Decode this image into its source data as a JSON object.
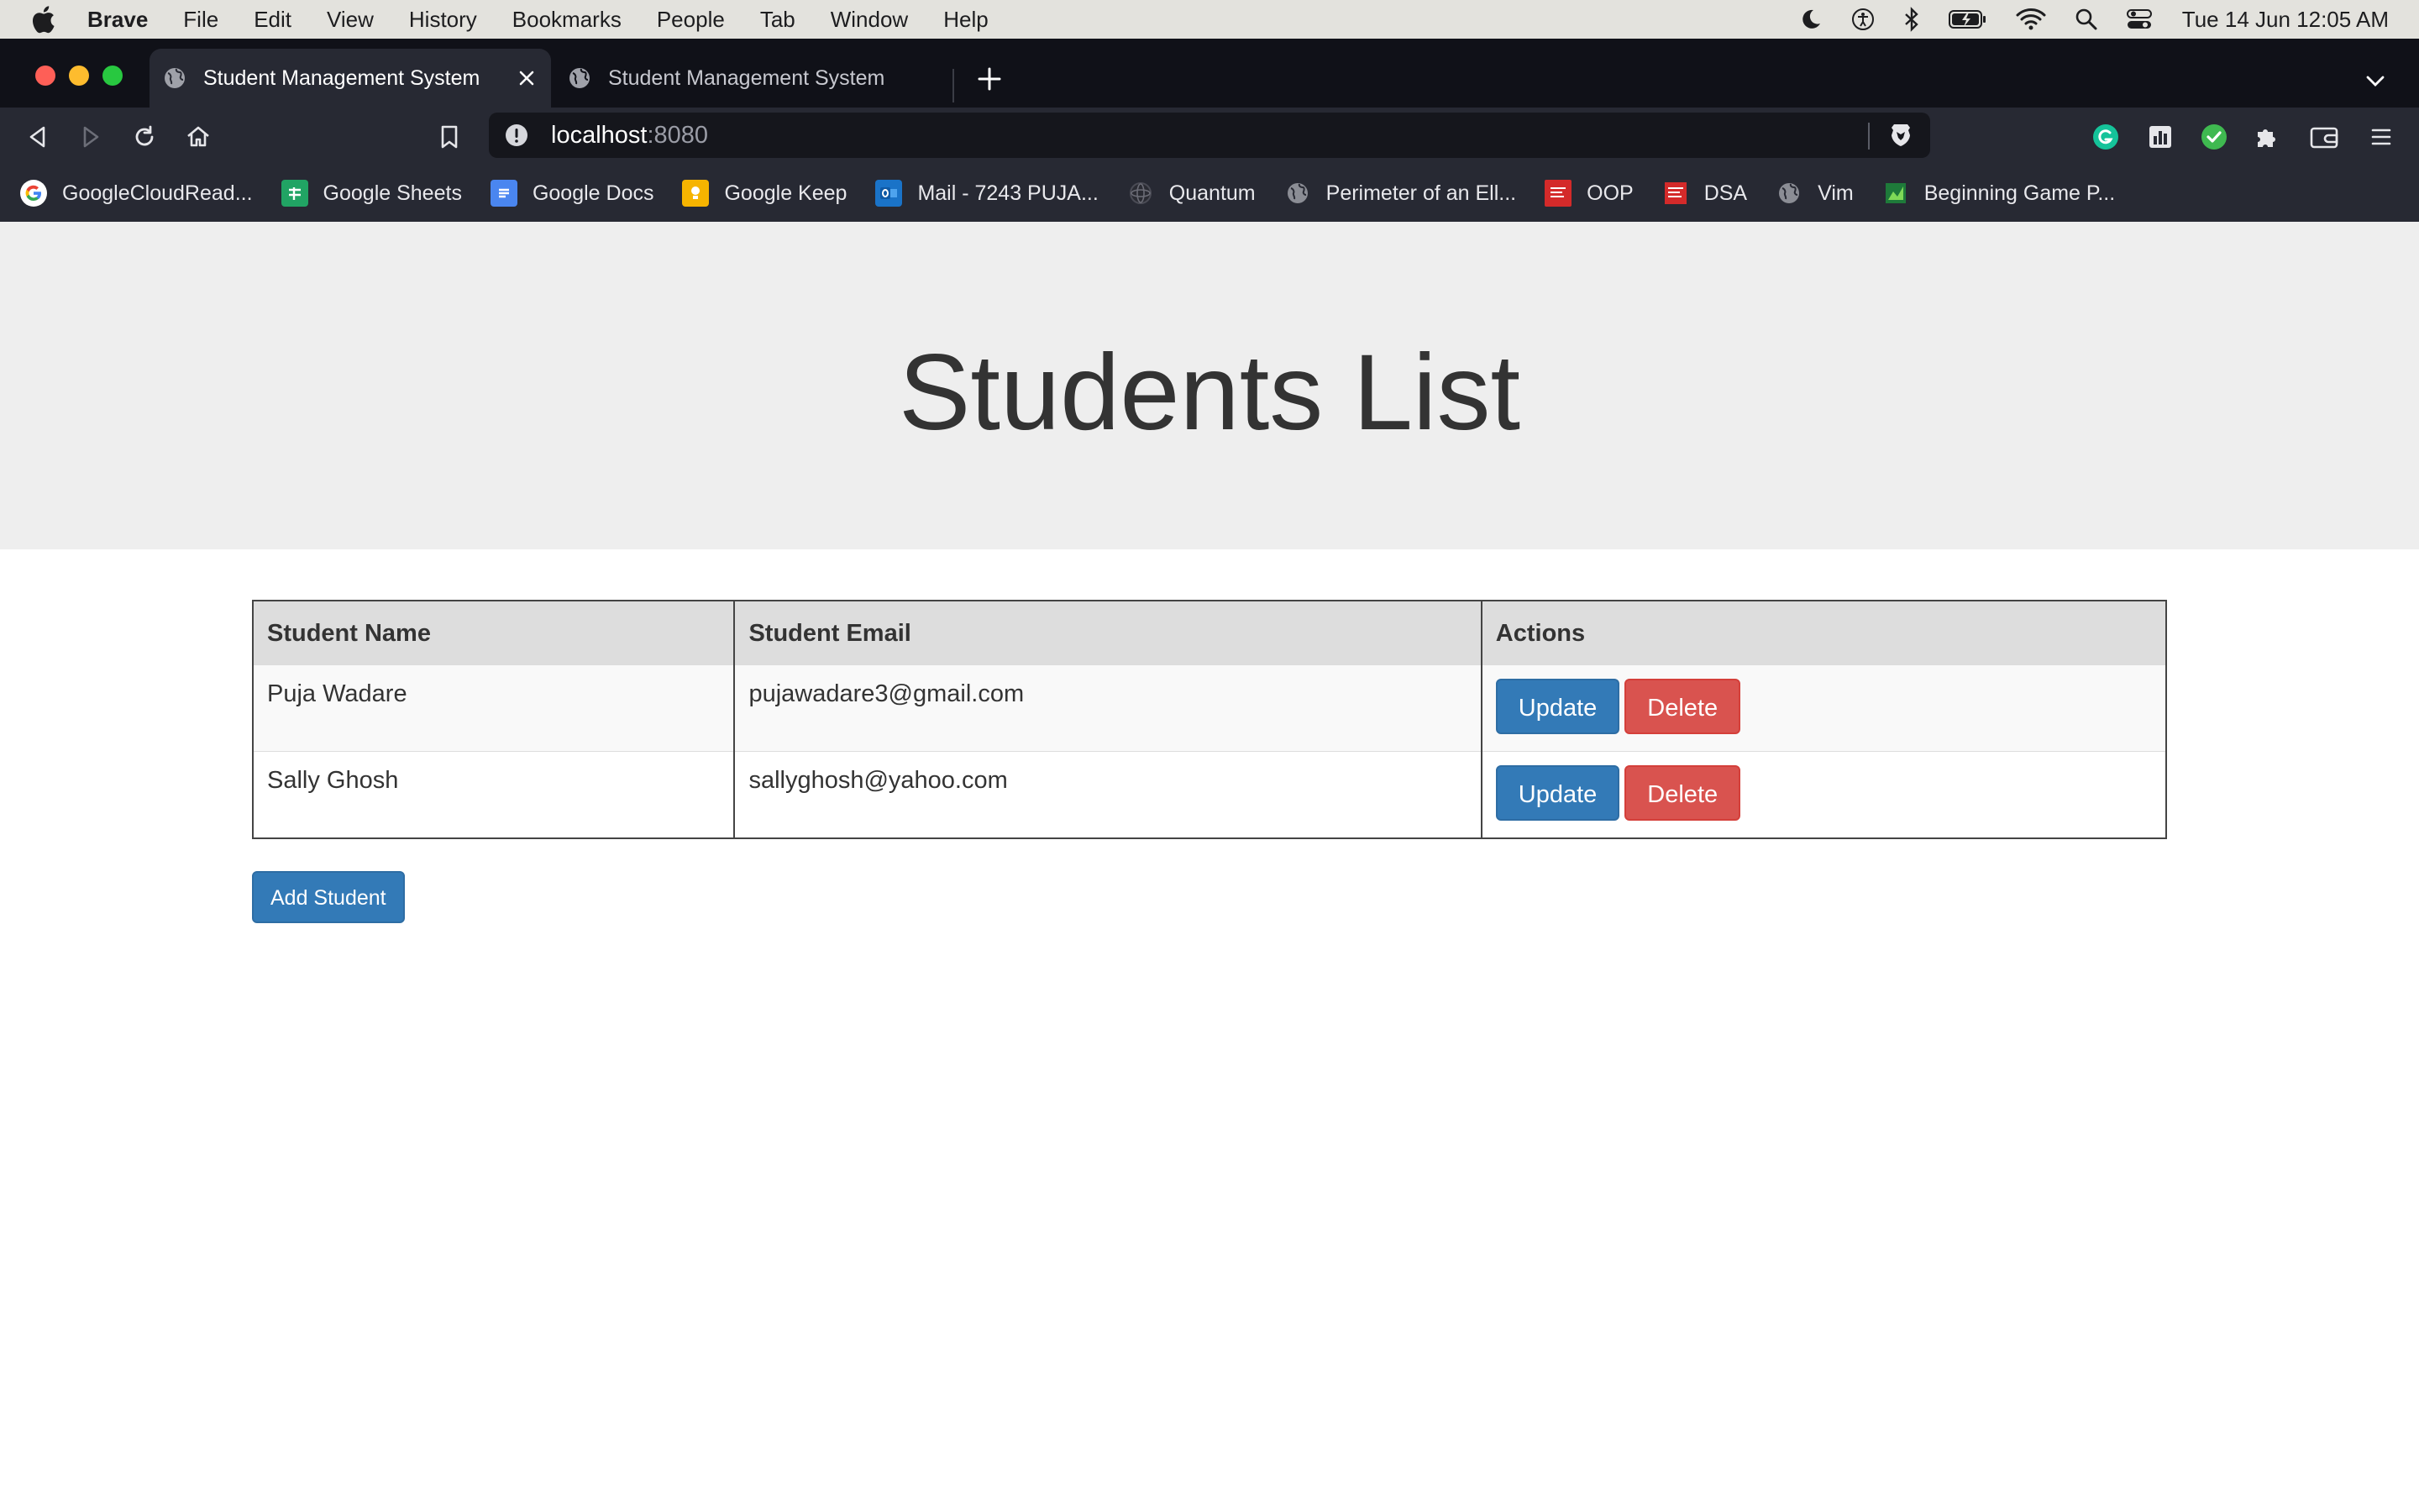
{
  "menubar": {
    "app_name": "Brave",
    "items": [
      "File",
      "Edit",
      "View",
      "History",
      "Bookmarks",
      "People",
      "Tab",
      "Window",
      "Help"
    ],
    "clock": "Tue 14 Jun  12:05 AM"
  },
  "tabs": [
    {
      "title": "Student Management System",
      "active": true
    },
    {
      "title": "Student Management System",
      "active": false
    }
  ],
  "address_bar": {
    "host": "localhost",
    "port": ":8080"
  },
  "bookmarks": [
    {
      "label": "GoogleCloudRead...",
      "icon": "google-g-icon"
    },
    {
      "label": "Google Sheets",
      "icon": "sheets-icon"
    },
    {
      "label": "Google Docs",
      "icon": "docs-icon"
    },
    {
      "label": "Google Keep",
      "icon": "keep-icon"
    },
    {
      "label": "Mail - 7243 PUJA...",
      "icon": "outlook-icon"
    },
    {
      "label": "Quantum",
      "icon": "quantum-icon"
    },
    {
      "label": "Perimeter of an Ell...",
      "icon": "globe-icon"
    },
    {
      "label": "OOP",
      "icon": "mcgraw-hill-icon"
    },
    {
      "label": "DSA",
      "icon": "mcgraw-hill-icon"
    },
    {
      "label": "Vim",
      "icon": "globe-icon"
    },
    {
      "label": "Beginning Game P...",
      "icon": "chart-icon"
    }
  ],
  "page": {
    "heading": "Students List",
    "table": {
      "headers": [
        "Student Name",
        "Student Email",
        "Actions"
      ],
      "rows": [
        {
          "name": "Puja Wadare",
          "email": "pujawadare3@gmail.com"
        },
        {
          "name": "Sally Ghosh",
          "email": "sallyghosh@yahoo.com"
        }
      ],
      "update_label": "Update",
      "delete_label": "Delete"
    },
    "add_button": "Add Student"
  },
  "colors": {
    "primary": "#337ab7",
    "danger": "#d9534f",
    "jumbotron_bg": "#eeeeee",
    "chrome_bg": "#272933"
  }
}
